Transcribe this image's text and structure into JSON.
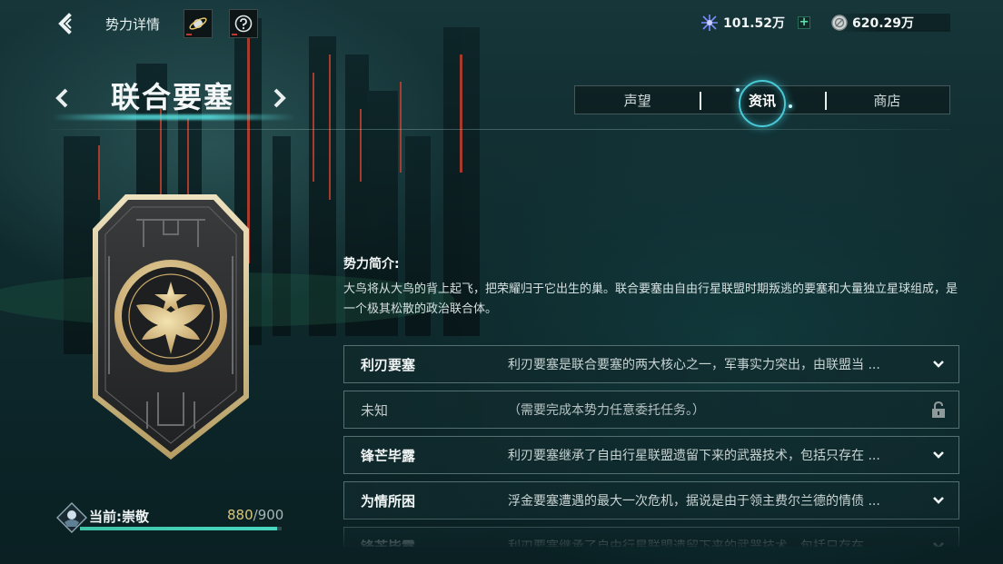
{
  "header": {
    "title": "势力详情",
    "icons": [
      "planet-icon",
      "help-icon"
    ]
  },
  "resources": [
    {
      "icon": "crystal-icon",
      "value": "101.52万"
    },
    {
      "icon": "coin-icon",
      "value": "620.29万"
    }
  ],
  "faction": {
    "name": "联合要塞"
  },
  "tabs": [
    {
      "label": "声望",
      "active": false
    },
    {
      "label": "资讯",
      "active": true
    },
    {
      "label": "商店",
      "active": false
    }
  ],
  "intro": {
    "title": "势力简介:",
    "body": "大鸟将从大鸟的背上起飞，把荣耀归于它出生的巢。联合要塞由自由行星联盟时期叛逃的要塞和大量独立星球组成，是一个极其松散的政治联合体。"
  },
  "entries": [
    {
      "title": "利刃要塞",
      "desc": "利刃要塞是联合要塞的两大核心之一，军事实力突出，由联盟当 ...",
      "icon": "chevron-down-icon",
      "locked": false
    },
    {
      "title": "未知",
      "desc": "（需要完成本势力任意委托任务。）",
      "icon": "lock-icon",
      "locked": true
    },
    {
      "title": "锋芒毕露",
      "desc": "利刃要塞继承了自由行星联盟遗留下来的武器技术，包括只存在 ...",
      "icon": "chevron-down-icon",
      "locked": false
    },
    {
      "title": "为情所困",
      "desc": "浮金要塞遭遇的最大一次危机，据说是由于领主费尔兰德的情债 ...",
      "icon": "chevron-down-icon",
      "locked": false
    },
    {
      "title": "锋芒毕露",
      "desc": "利刃要塞继承了自由行星联盟遗留下来的武器技术，包括只存在 ...",
      "icon": "chevron-down-icon",
      "locked": false
    }
  ],
  "reputation": {
    "label": "当前:崇敬",
    "current": "880",
    "separator": "/",
    "max": "900",
    "progress": 0.978
  },
  "colors": {
    "accent": "#49d7c0",
    "gold": "#d9c57a",
    "tab_glow": "#50dceb"
  }
}
